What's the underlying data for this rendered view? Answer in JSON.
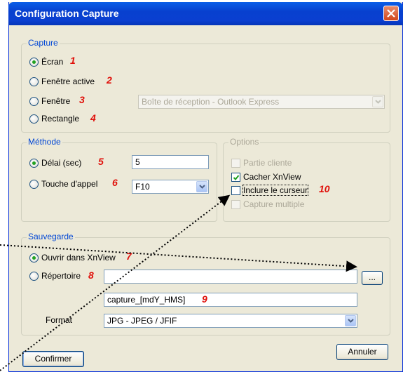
{
  "window": {
    "title": "Configuration Capture"
  },
  "capture": {
    "legend": "Capture",
    "options": [
      {
        "label": "Écran",
        "selected": true,
        "marker": "1"
      },
      {
        "label": "Fenêtre active",
        "selected": false,
        "marker": "2"
      },
      {
        "label": "Fenêtre",
        "selected": false,
        "marker": "3"
      },
      {
        "label": "Rectangle",
        "selected": false,
        "marker": "4"
      }
    ],
    "window_select": {
      "value": "Boîte de réception - Outlook Express",
      "disabled": true
    }
  },
  "methode": {
    "legend": "Méthode",
    "delay": {
      "label": "Délai (sec)",
      "selected": true,
      "marker": "5",
      "value": "5"
    },
    "hotkey": {
      "label": "Touche d'appel",
      "selected": false,
      "marker": "6",
      "value": "F10"
    }
  },
  "options": {
    "legend": "Options",
    "items": [
      {
        "label": "Partie cliente",
        "checked": false,
        "disabled": true
      },
      {
        "label": "Cacher XnView",
        "checked": true,
        "disabled": false
      },
      {
        "label": "Inclure le curseur",
        "checked": false,
        "disabled": false,
        "marker": "10"
      },
      {
        "label": "Capture multiple",
        "checked": false,
        "disabled": true
      }
    ]
  },
  "sauvegarde": {
    "legend": "Sauvegarde",
    "open_xnview": {
      "label": "Ouvrir dans XnView",
      "selected": true,
      "marker": "7"
    },
    "directory": {
      "label": "Répertoire",
      "selected": false,
      "marker": "8",
      "value": ""
    },
    "browse_label": "...",
    "filename": {
      "value": "capture_[mdY_HMS]",
      "marker": "9"
    },
    "format": {
      "label": "Format",
      "value": "JPG - JPEG / JFIF"
    }
  },
  "buttons": {
    "confirm": "Confirmer",
    "cancel": "Annuler"
  },
  "colors": {
    "title_bar": "#0a5ee8",
    "legend": "#0046d5",
    "marker": "#e0100a",
    "window_bg": "#ece9d8"
  }
}
